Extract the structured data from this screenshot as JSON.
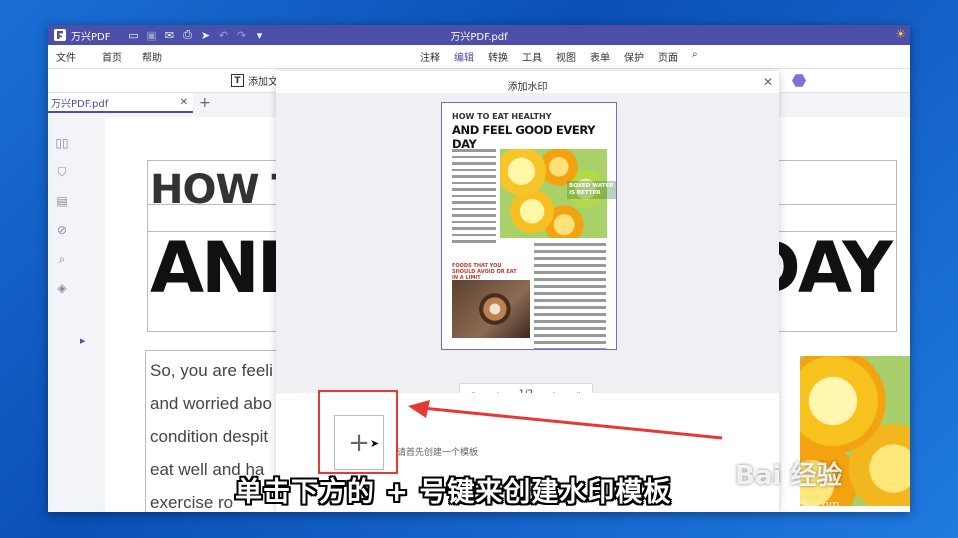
{
  "titlebar": {
    "app_name": "万兴PDF",
    "doc_title": "万兴PDF.pdf",
    "icons": [
      "folder-icon",
      "save-icon",
      "mail-icon",
      "print-icon",
      "share-icon",
      "undo-icon",
      "redo-icon",
      "dropdown-icon"
    ]
  },
  "menubar": {
    "left": [
      "文件",
      "首页",
      "帮助"
    ],
    "center": [
      "注释",
      "编辑",
      "转换",
      "工具",
      "视图",
      "表单",
      "保护",
      "页面"
    ],
    "active": "编辑"
  },
  "toolstrip": {
    "add_text": "添加文"
  },
  "tabs": [
    {
      "label": "万兴PDF.pdf"
    }
  ],
  "document": {
    "heading_small": "HOW TO",
    "heading_large_left": "AND",
    "heading_large_right": "DAY",
    "body_lines": [
      "So, you are feeli",
      "and worried abo",
      "condition despit",
      "eat well and ha",
      "exercise ro"
    ]
  },
  "dialog": {
    "title": "添加水印",
    "preview": {
      "title_small": "HOW TO EAT HEALTHY",
      "title_large": "AND FEEL GOOD EVERY DAY",
      "badge": "BOXED WATER IS BETTER",
      "subheading": "FOODS THAT YOU SHOULD AVOID OR EAT IN A LIMIT"
    },
    "pager": {
      "first": "«",
      "prev": "‹",
      "page": "1",
      "total": "/2",
      "next": "›",
      "last": "»"
    },
    "template_hint": "请首先创建一个模板",
    "add_template_label": "+"
  },
  "annotation": {
    "caption": "单击下方的 + 号键来创建水印模板",
    "watermark": "Bai 经验",
    "watermark_url": "jingyan.baidu.com"
  },
  "colors": {
    "accent": "#4b4fa8",
    "annotation_red": "#e53935"
  }
}
